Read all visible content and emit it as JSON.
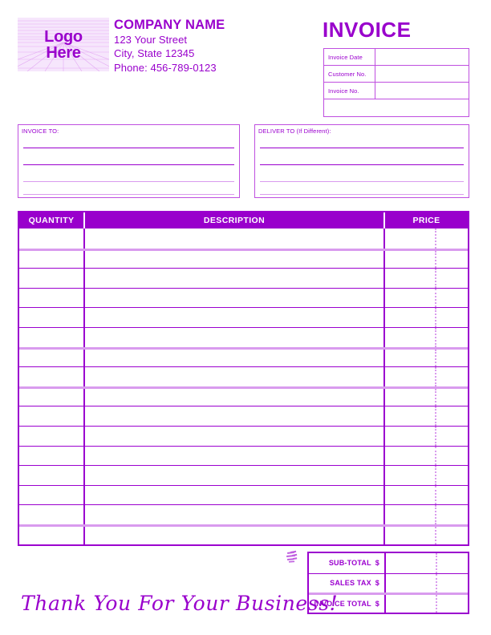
{
  "colors": {
    "accent": "#9900CC",
    "accent_light": "#D99BEE",
    "accent_mid": "#BF4FE0",
    "header_text": "#FFFFFF",
    "page_background": "#FFFFFF"
  },
  "header": {
    "logo": {
      "line1": "Logo",
      "line2": "Here"
    },
    "company": {
      "name": "COMPANY NAME",
      "street": "123 Your Street",
      "city_state_zip": "City, State 12345",
      "phone": "Phone: 456-789-0123"
    },
    "document_title": "INVOICE"
  },
  "invoice_meta": {
    "rows": [
      {
        "label": "Invoice Date",
        "value": ""
      },
      {
        "label": "Customer No.",
        "value": ""
      },
      {
        "label": "Invoice No.",
        "value": ""
      }
    ],
    "blank_row_value": ""
  },
  "addresses": {
    "invoice_to": {
      "label": "INVOICE TO:",
      "line_count": 4,
      "lines": [
        "",
        "",
        "",
        ""
      ]
    },
    "deliver_to": {
      "label": "DELIVER TO (If Different):",
      "line_count": 4,
      "lines": [
        "",
        "",
        "",
        ""
      ]
    }
  },
  "items_table": {
    "columns": [
      "QUANTITY",
      "DESCRIPTION",
      "PRICE"
    ],
    "row_count": 16,
    "rows": [
      {
        "quantity": "",
        "description": "",
        "price": ""
      },
      {
        "quantity": "",
        "description": "",
        "price": ""
      },
      {
        "quantity": "",
        "description": "",
        "price": ""
      },
      {
        "quantity": "",
        "description": "",
        "price": ""
      },
      {
        "quantity": "",
        "description": "",
        "price": ""
      },
      {
        "quantity": "",
        "description": "",
        "price": ""
      },
      {
        "quantity": "",
        "description": "",
        "price": ""
      },
      {
        "quantity": "",
        "description": "",
        "price": ""
      },
      {
        "quantity": "",
        "description": "",
        "price": ""
      },
      {
        "quantity": "",
        "description": "",
        "price": ""
      },
      {
        "quantity": "",
        "description": "",
        "price": ""
      },
      {
        "quantity": "",
        "description": "",
        "price": ""
      },
      {
        "quantity": "",
        "description": "",
        "price": ""
      },
      {
        "quantity": "",
        "description": "",
        "price": ""
      },
      {
        "quantity": "",
        "description": "",
        "price": ""
      },
      {
        "quantity": "",
        "description": "",
        "price": ""
      }
    ]
  },
  "totals": {
    "rows": [
      {
        "label": "SUB-TOTAL",
        "currency": "$",
        "value": ""
      },
      {
        "label": "SALES TAX",
        "currency": "$",
        "value": ""
      },
      {
        "label": "INVOICE TOTAL",
        "currency": "$",
        "value": ""
      }
    ]
  },
  "footer": {
    "thank_you": "Thank You For Your Business!"
  }
}
